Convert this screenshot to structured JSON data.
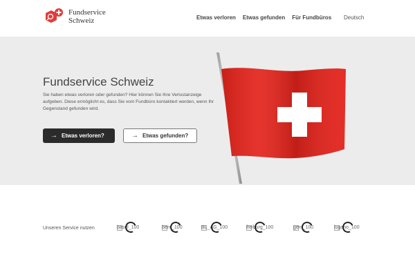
{
  "brand": {
    "line1": "Fundservice",
    "line2": "Schweiz",
    "accent": "#e23b3b"
  },
  "nav": {
    "items": [
      "Etwas verloren",
      "Etwas gefunden",
      "Für Fundbüros"
    ],
    "language": "Deutsch"
  },
  "hero": {
    "title": "Fundservice Schweiz",
    "description": "Sie haben etwas verloren oder gefunden? Hier können Sie Ihre Verlustanzeige aufgeben. Diese ermöglicht es, dass Sie vom Fundbüro kontaktiert werden, wenn Ihr Gegenstand gefunden wird.",
    "btn_lost": "Etwas verloren?",
    "btn_found": "Etwas gefunden?",
    "flag_color": "#e3231b"
  },
  "services": {
    "label": "Unseren Service nutzen",
    "logos": [
      "basel_100",
      "bern_100",
      "BL_AG_100",
      "freiburg_100",
      "genf_100",
      "lugano_100"
    ]
  }
}
